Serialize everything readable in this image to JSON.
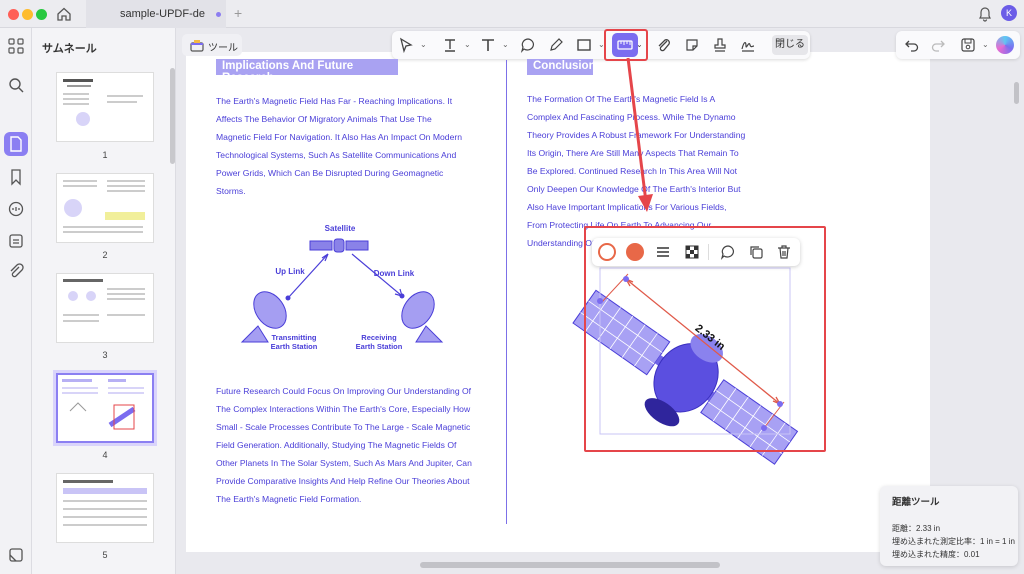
{
  "window": {
    "tab_title": "sample-UPDF-de",
    "avatar_letter": "K"
  },
  "sidebar": {
    "title": "サムネール",
    "pages": [
      "1",
      "2",
      "3",
      "4",
      "5"
    ],
    "selected_page": "4"
  },
  "toolbar": {
    "tools_label": "ツール",
    "close_label": "閉じる"
  },
  "left_column": {
    "heading": "Implications And Future Research",
    "para1": [
      "The Earth's Magnetic Field Has Far - Reaching Implications. It",
      "Affects The Behavior Of Migratory Animals That Use The",
      "Magnetic Field For Navigation. It Also Has An Impact On Modern",
      "Technological Systems, Such As Satellite Communications And",
      "Power Grids, Which Can Be Disrupted During Geomagnetic",
      "Storms."
    ],
    "diagram": {
      "satellite": "Satellite",
      "uplink": "Up Link",
      "downlink": "Down Link",
      "tx1": "Transmitting",
      "tx2": "Earth Station",
      "rx1": "Receiving",
      "rx2": "Earth Station"
    },
    "para2": [
      "Future Research Could Focus On Improving Our Understanding Of",
      "The Complex Interactions Within The Earth's Core, Especially How",
      "Small - Scale Processes Contribute To The Large - Scale Magnetic",
      "Field Generation. Additionally, Studying The Magnetic Fields Of",
      "Other Planets In The Solar System, Such As Mars And Jupiter, Can",
      "Provide Comparative Insights And Help Refine Our Theories About",
      "The Earth's Magnetic Field Formation."
    ]
  },
  "right_column": {
    "heading": "Conclusion",
    "para": [
      "The Formation Of The Earth's Magnetic Field Is A",
      "Complex And Fascinating Process. While The Dynamo",
      "Theory Provides A Robust Framework For Understanding",
      "Its Origin, There Are Still Many Aspects That Remain To",
      "Be Explored. Continued Research In This Area Will Not",
      "Only Deepen Our Knowledge Of The Earth's Interior But",
      "Also Have Important Implications For Various Fields,",
      "From Protecting Life On Earth To Advancing Our",
      "Understanding Of"
    ]
  },
  "measure": {
    "label": "2.33 in"
  },
  "info_panel": {
    "title": "距離ツール",
    "line1": "距離：2.33 in",
    "line2": "埋め込まれた測定比率：1 in = 1 in",
    "line3": "埋め込まれた精度：0.01"
  },
  "colors": {
    "accent": "#7b6cf0",
    "text": "#4a3ed8",
    "highlight": "#e5454a",
    "stroke_color": "#e86848"
  }
}
